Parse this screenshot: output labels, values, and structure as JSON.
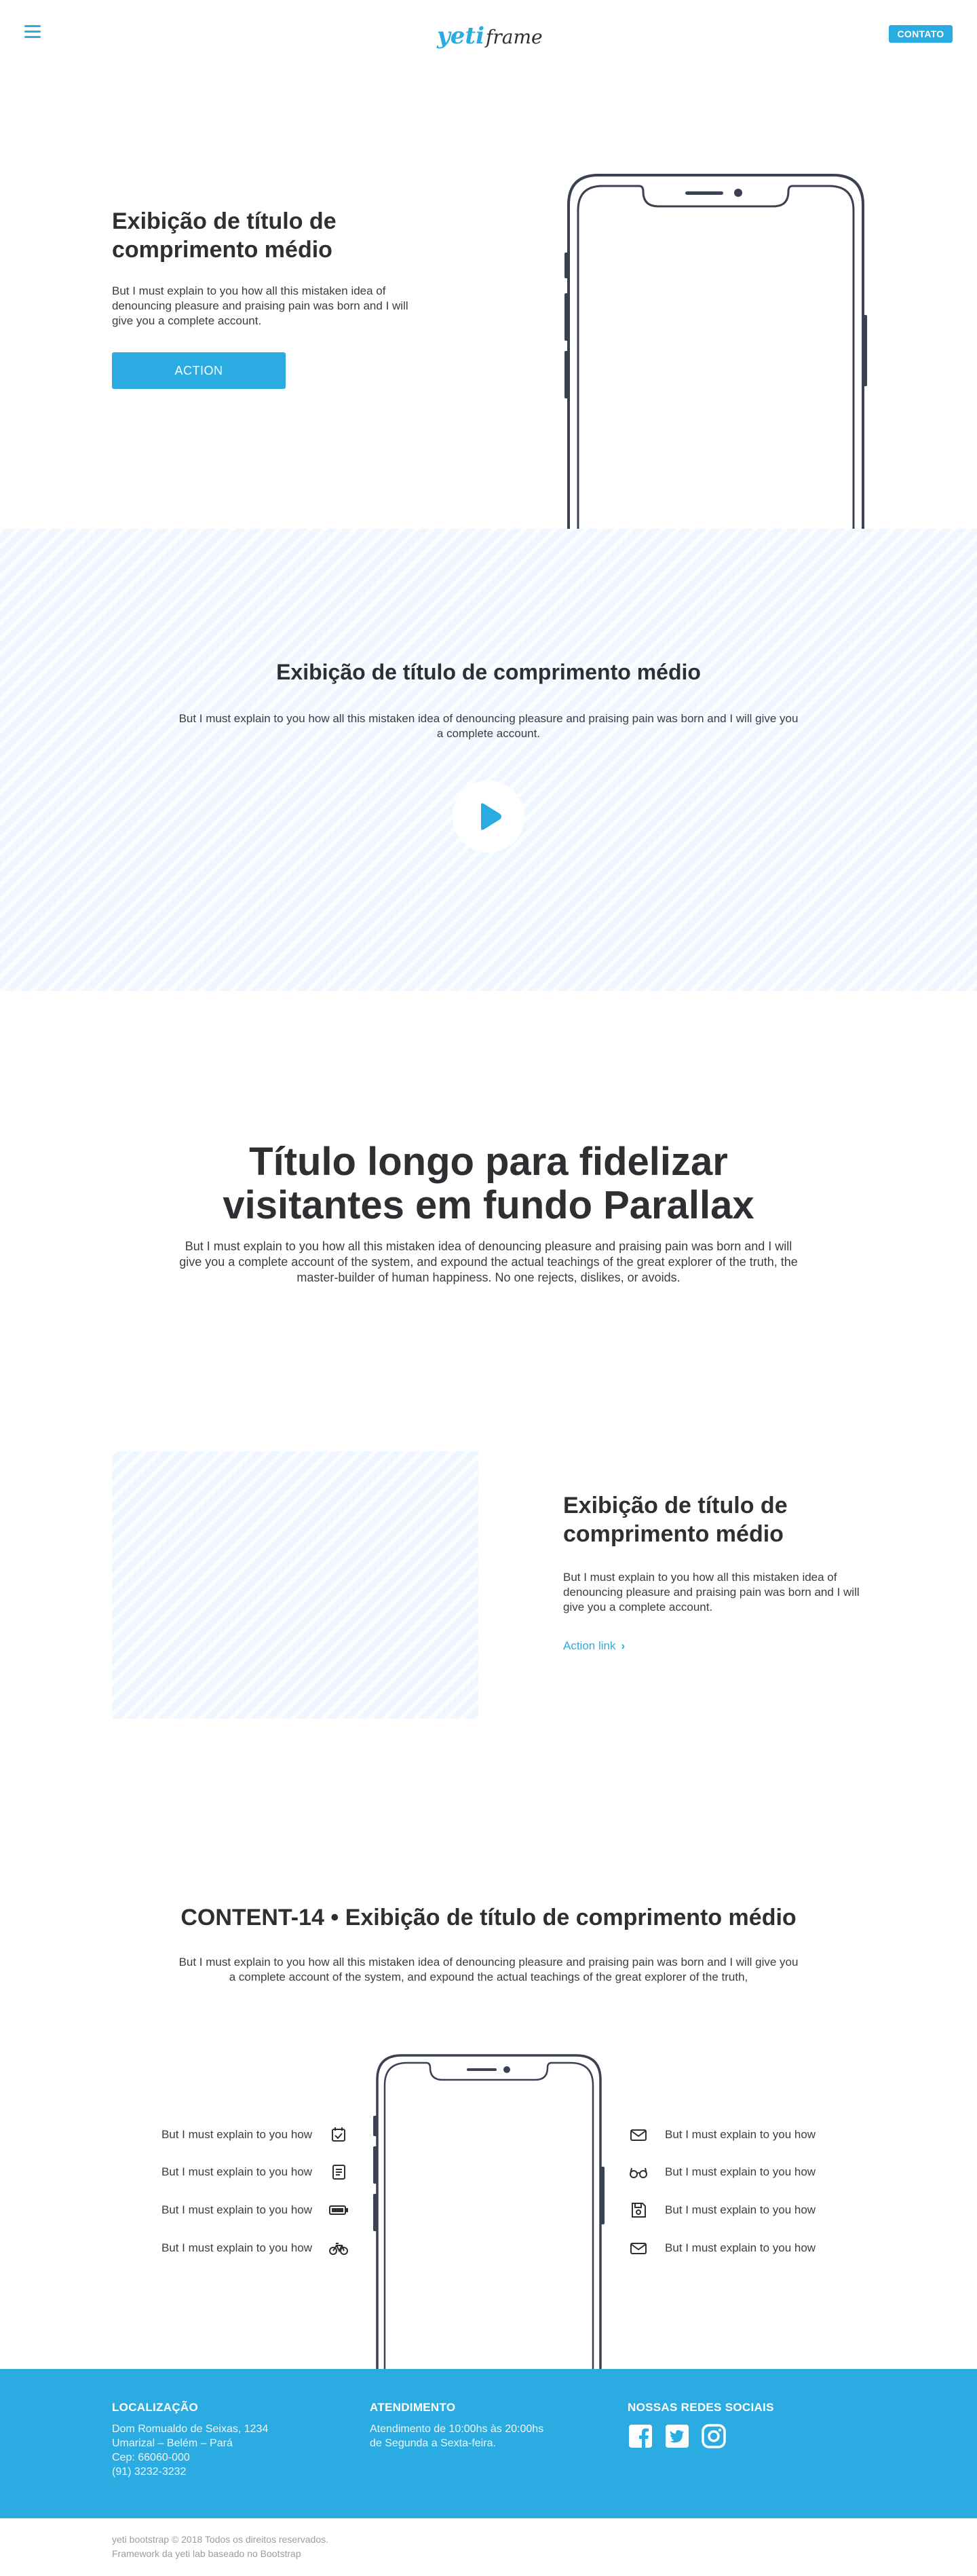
{
  "header": {
    "logo_part1": "yeti",
    "logo_part2": "frame",
    "contact_button": "CONTATO"
  },
  "hero": {
    "title": "Exibição de título de comprimento médio",
    "text": "But I must explain to you how all this mistaken idea of denouncing pleasure and praising pain was born and I will give you a complete account.",
    "button": "ACTION"
  },
  "video_section": {
    "title": "Exibição de título de comprimento médio",
    "text": "But I must explain to you how all this mistaken idea of denouncing pleasure and praising pain was born and I will give you a complete account."
  },
  "parallax": {
    "title": "Título longo para fidelizar visitantes em fundo Parallax",
    "text": "But I must explain to you how all this mistaken idea of denouncing pleasure and praising pain was born and I will give you a complete account of the system, and expound the actual teachings of the great explorer of the truth, the master-builder of human happiness. No one rejects, dislikes, or avoids."
  },
  "media_section": {
    "title": "Exibição de título de comprimento médio",
    "text": "But I must explain to you how all this mistaken idea of denouncing pleasure and praising pain was born and I will give you a complete account.",
    "link": "Action link"
  },
  "content14": {
    "title": "CONTENT-14 • Exibição de título de comprimento médio",
    "text": "But I must explain to you how all this mistaken idea of denouncing pleasure and praising pain was born and I will give you a complete account of the system, and expound the actual teachings of the great explorer of the truth,",
    "features_left": [
      {
        "label": "But I must explain to you how",
        "icon": "calendar-check-icon"
      },
      {
        "label": "But I must explain to you how",
        "icon": "contact-card-icon"
      },
      {
        "label": "But I must explain to you how",
        "icon": "battery-icon"
      },
      {
        "label": "But I must explain to you how",
        "icon": "bicycle-icon"
      }
    ],
    "features_right": [
      {
        "label": "But I must explain to you how",
        "icon": "envelope-icon"
      },
      {
        "label": "But I must explain to you how",
        "icon": "glasses-icon"
      },
      {
        "label": "But I must explain to you how",
        "icon": "save-disk-icon"
      },
      {
        "label": "But I must explain to you how",
        "icon": "envelope-icon"
      }
    ]
  },
  "footer": {
    "location_title": "LOCALIZAÇÃO",
    "location_lines": [
      "Dom Romualdo de Seixas, 1234",
      "Umarizal – Belém – Pará",
      "Cep: 66060-000",
      "(91) 3232-3232"
    ],
    "service_title": "ATENDIMENTO",
    "service_lines": [
      "Atendimento de 10:00hs às 20:00hs",
      "de Segunda a Sexta-feira."
    ],
    "social_title": "NOSSAS REDES SOCIAIS",
    "social_icons": [
      "facebook-icon",
      "twitter-icon",
      "instagram-icon"
    ],
    "copyright": "yeti bootstrap © 2018 Todos os direitos reservados.",
    "credit": "Framework da yeti lab baseado no Bootstrap"
  },
  "colors": {
    "accent": "#2aace2",
    "text": "#2d2f33",
    "stripe_bg": "#eef6ff"
  }
}
